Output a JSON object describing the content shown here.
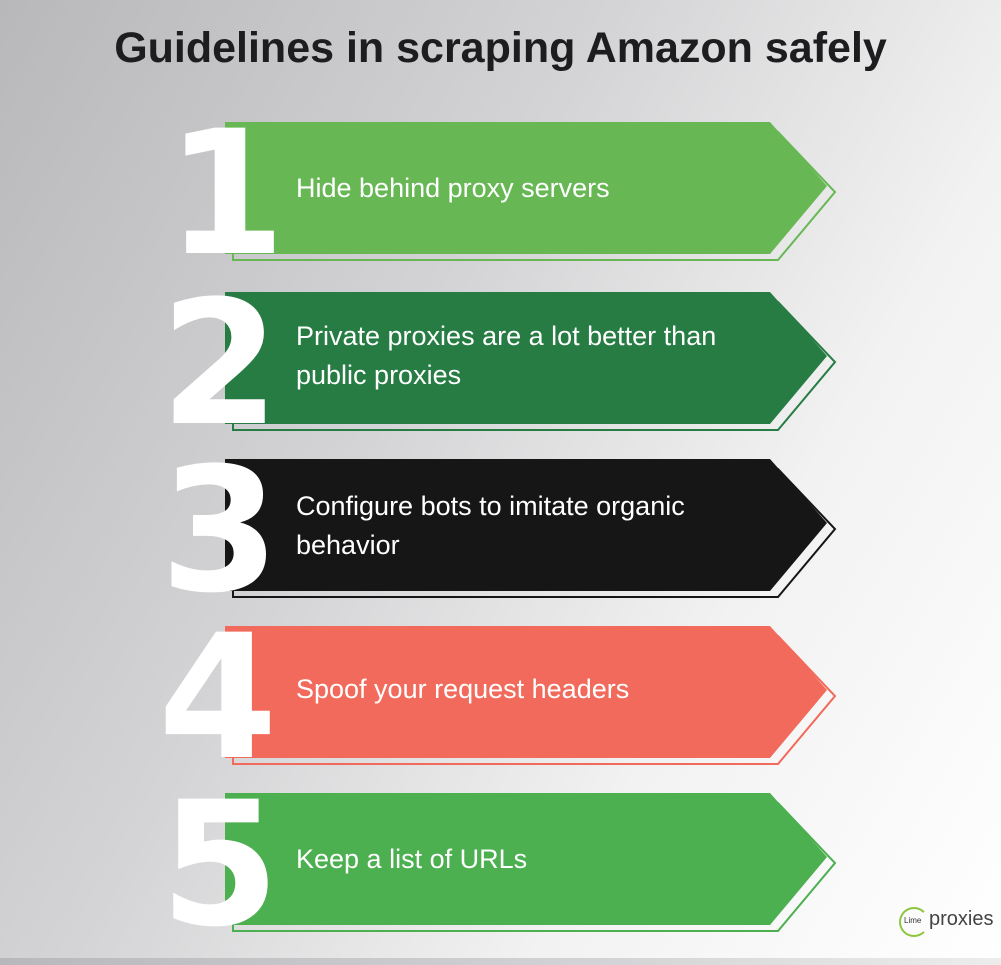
{
  "title": "Guidelines in scraping Amazon safely",
  "items": [
    {
      "number": "1",
      "text": "Hide behind proxy servers",
      "color": "#67b854",
      "outline": "#67b854"
    },
    {
      "number": "2",
      "text": "Private proxies are a lot better than public proxies",
      "color": "#267c43",
      "outline": "#267c43"
    },
    {
      "number": "3",
      "text": "Configure bots to imitate organic behavior",
      "color": "#161616",
      "outline": "#161616"
    },
    {
      "number": "4",
      "text": "Spoof your request headers",
      "color": "#f26a5b",
      "outline": "#f26a5b"
    },
    {
      "number": "5",
      "text": "Keep a list of URLs",
      "color": "#4caf50",
      "outline": "#4caf50"
    }
  ],
  "logo": {
    "small": "Lime",
    "big": "proxies"
  }
}
